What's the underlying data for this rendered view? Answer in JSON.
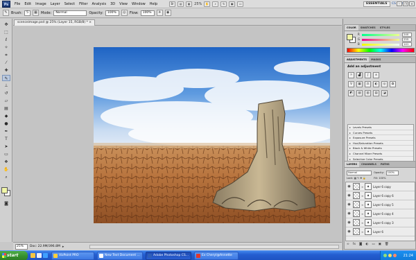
{
  "app": {
    "logo": "Ps",
    "menu": [
      "File",
      "Edit",
      "Image",
      "Layer",
      "Select",
      "Filter",
      "Analysis",
      "3D",
      "View",
      "Window",
      "Help"
    ],
    "zoom_display": "25%",
    "workspace": "ESSENTIALS",
    "cs_live": "CS Live"
  },
  "options": {
    "brush_label": "Brush:",
    "brush_size": "5",
    "mode_label": "Mode:",
    "mode_value": "Normal",
    "opacity_label": "Opacity:",
    "opacity_value": "100%",
    "flow_label": "Flow:",
    "flow_value": "100%"
  },
  "document": {
    "tab_title": "scenceimage.psd @ 25% (Layer 15, RGB/8) *",
    "status_zoom": "25%",
    "status_doc": "Doc: 22.9M/396.8M"
  },
  "colors": {
    "foreground": "#f2f7a8",
    "background": "#ffffff"
  },
  "color_panel": {
    "tabs": [
      "COLOR",
      "SWATCHES",
      "STYLES"
    ],
    "r_label": "R",
    "r_value": "240",
    "g_label": "G",
    "g_value": "255",
    "b_label": "B",
    "b_value": "141"
  },
  "adjustments": {
    "tabs": [
      "ADJUSTMENTS",
      "MASKS"
    ],
    "title": "Add an adjustment",
    "presets": [
      "Levels Presets",
      "Curves Presets",
      "Exposure Presets",
      "Hue/Saturation Presets",
      "Black & White Presets",
      "Channel Mixer Presets",
      "Selective Color Presets"
    ]
  },
  "layers": {
    "tabs": [
      "LAYERS",
      "CHANNELS",
      "PATHS"
    ],
    "blend_mode": "Normal",
    "opacity_label": "Opacity:",
    "opacity_value": "100%",
    "fill_label": "Fill:",
    "fill_value": "100%",
    "lock_label": "Lock:",
    "items": [
      "Layer 6 copy",
      "Layer 6 copy 6",
      "Layer 6 copy 5",
      "Layer 6 copy 4",
      "Layer 6 copy 3",
      "Layer 6"
    ]
  },
  "taskbar": {
    "start": "start",
    "tasks": [
      "VizPoint PRO",
      "New Text Document ...",
      "Adobe Photoshop CS...",
      "Ex Cheryl@Annette"
    ],
    "clock": "21:24"
  }
}
